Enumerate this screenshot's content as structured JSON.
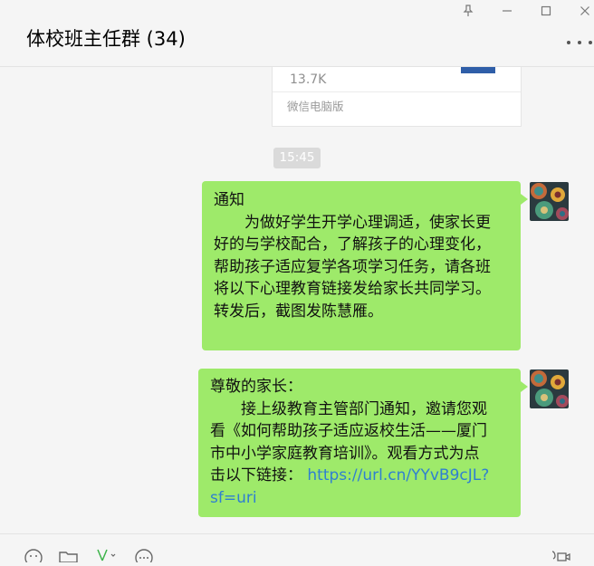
{
  "window": {
    "title": "体校班主任群 (34)",
    "controls": [
      "pin-icon",
      "minimize-icon",
      "maximize-icon",
      "close-icon"
    ]
  },
  "file_card": {
    "size": "13.7K",
    "source": "微信电脑版"
  },
  "timestamp": "15:45",
  "messages": [
    {
      "sender": "self",
      "lines": [
        "通知",
        "　　为做好学生开学心理调适，使家长更",
        "好的与学校配合，了解孩子的心理变化，",
        "帮助孩子适应复学各项学习任务，请各班",
        "将以下心理教育链接发给家长共同学习。",
        "转发后，截图发陈慧雁。"
      ]
    },
    {
      "sender": "self",
      "lines": [
        "尊敬的家长：",
        "　　接上级教育主管部门通知，邀请您观",
        "看《如何帮助孩子适应返校生活——厦门",
        "市中小学家庭教育培训》。观看方式为点"
      ],
      "link_prefix": "击以下链接：",
      "link_line1": "https://url.cn/YYvB9cJL?",
      "link_line2": "sf=uri"
    }
  ],
  "toolbar": {
    "icons": [
      "emoji-icon",
      "folder-icon",
      "scissors-icon",
      "chat-bubble-icon",
      "video-call-icon"
    ]
  },
  "colors": {
    "self_bubble": "#9eea6a",
    "link": "#2f7fd1",
    "background": "#f5f5f5"
  }
}
